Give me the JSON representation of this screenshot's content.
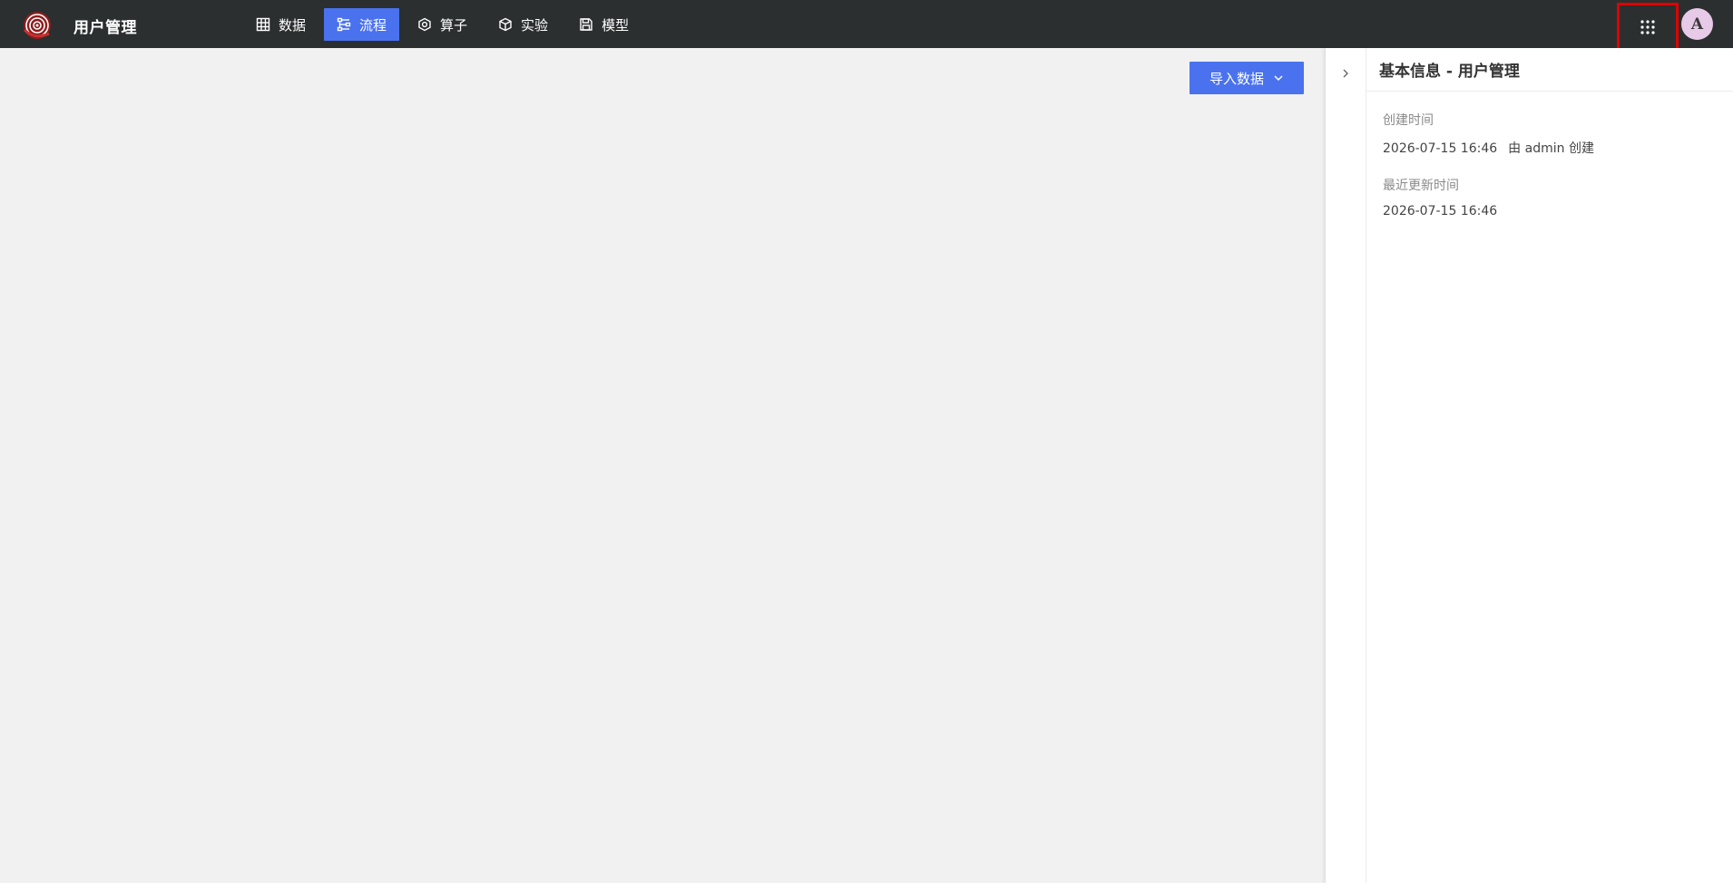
{
  "header": {
    "app_title": "用户管理",
    "nav": [
      {
        "label": "数据",
        "icon": "table-icon",
        "active": false
      },
      {
        "label": "流程",
        "icon": "flow-icon",
        "active": true
      },
      {
        "label": "算子",
        "icon": "hexagon-icon",
        "active": false
      },
      {
        "label": "实验",
        "icon": "cube-icon",
        "active": false
      },
      {
        "label": "模型",
        "icon": "save-icon",
        "active": false
      }
    ],
    "avatar_letter": "A",
    "accent_color": "#4a72ee"
  },
  "canvas": {
    "import_button_label": "导入数据"
  },
  "panel": {
    "title": "基本信息 - 用户管理",
    "created_label": "创建时间",
    "created_time": "2026-07-15 16:46",
    "created_by": "由 admin 创建",
    "updated_label": "最近更新时间",
    "updated_time": "2026-07-15 16:46"
  }
}
